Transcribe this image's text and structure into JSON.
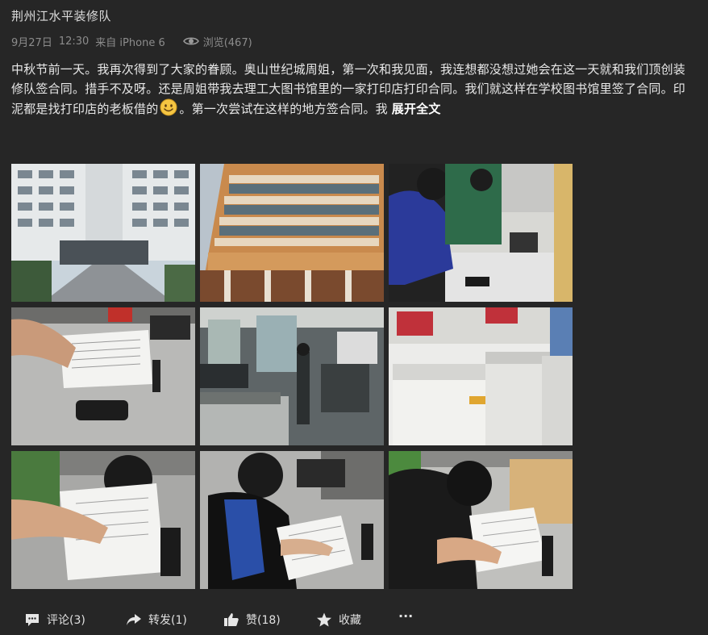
{
  "post": {
    "author": "荆州江水平装修队",
    "date": "9月27日",
    "time": "12:30",
    "source": "来自 iPhone 6",
    "views_label": "浏览(467)",
    "content_before_emoji": "中秋节前一天。我再次得到了大家的眷顾。奥山世纪城周姐，第一次和我见面，我连想都没想过她会在这一天就和我们顶创装修队签合同。措手不及呀。还是周姐带我去理工大图书馆里的一家打印店打印合同。我们就这样在学校图书馆里签了合同。印泥都是找打印店的老板借的",
    "content_after_emoji": "。第一次尝试在这样的地方签合同。我 ",
    "expand_label": "展开全文",
    "emoji_icon": "smiley-emoji-icon"
  },
  "photos": [
    {
      "name": "photo-building-white",
      "bg": "#9aa2a8"
    },
    {
      "name": "photo-building-library",
      "bg": "#c68a4c"
    },
    {
      "name": "photo-printshop-signing",
      "bg": "#cfcfcf"
    },
    {
      "name": "photo-contract-hand",
      "bg": "#bdbdbd"
    },
    {
      "name": "photo-printshop-interior",
      "bg": "#4c5456"
    },
    {
      "name": "photo-copy-machines",
      "bg": "#e2e2e2"
    },
    {
      "name": "photo-man-signing",
      "bg": "#a9a9a9"
    },
    {
      "name": "photo-woman-signing",
      "bg": "#8d8d8d"
    },
    {
      "name": "photo-man-signing-2",
      "bg": "#b8b8b8"
    }
  ],
  "actions": {
    "comment_label": "评论(3)",
    "repost_label": "转发(1)",
    "like_label": "赞(18)",
    "favorite_label": "收藏",
    "more_label": "···"
  },
  "colors": {
    "background": "#262626",
    "text": "#e8e8e8",
    "meta": "#8c8c8c"
  }
}
